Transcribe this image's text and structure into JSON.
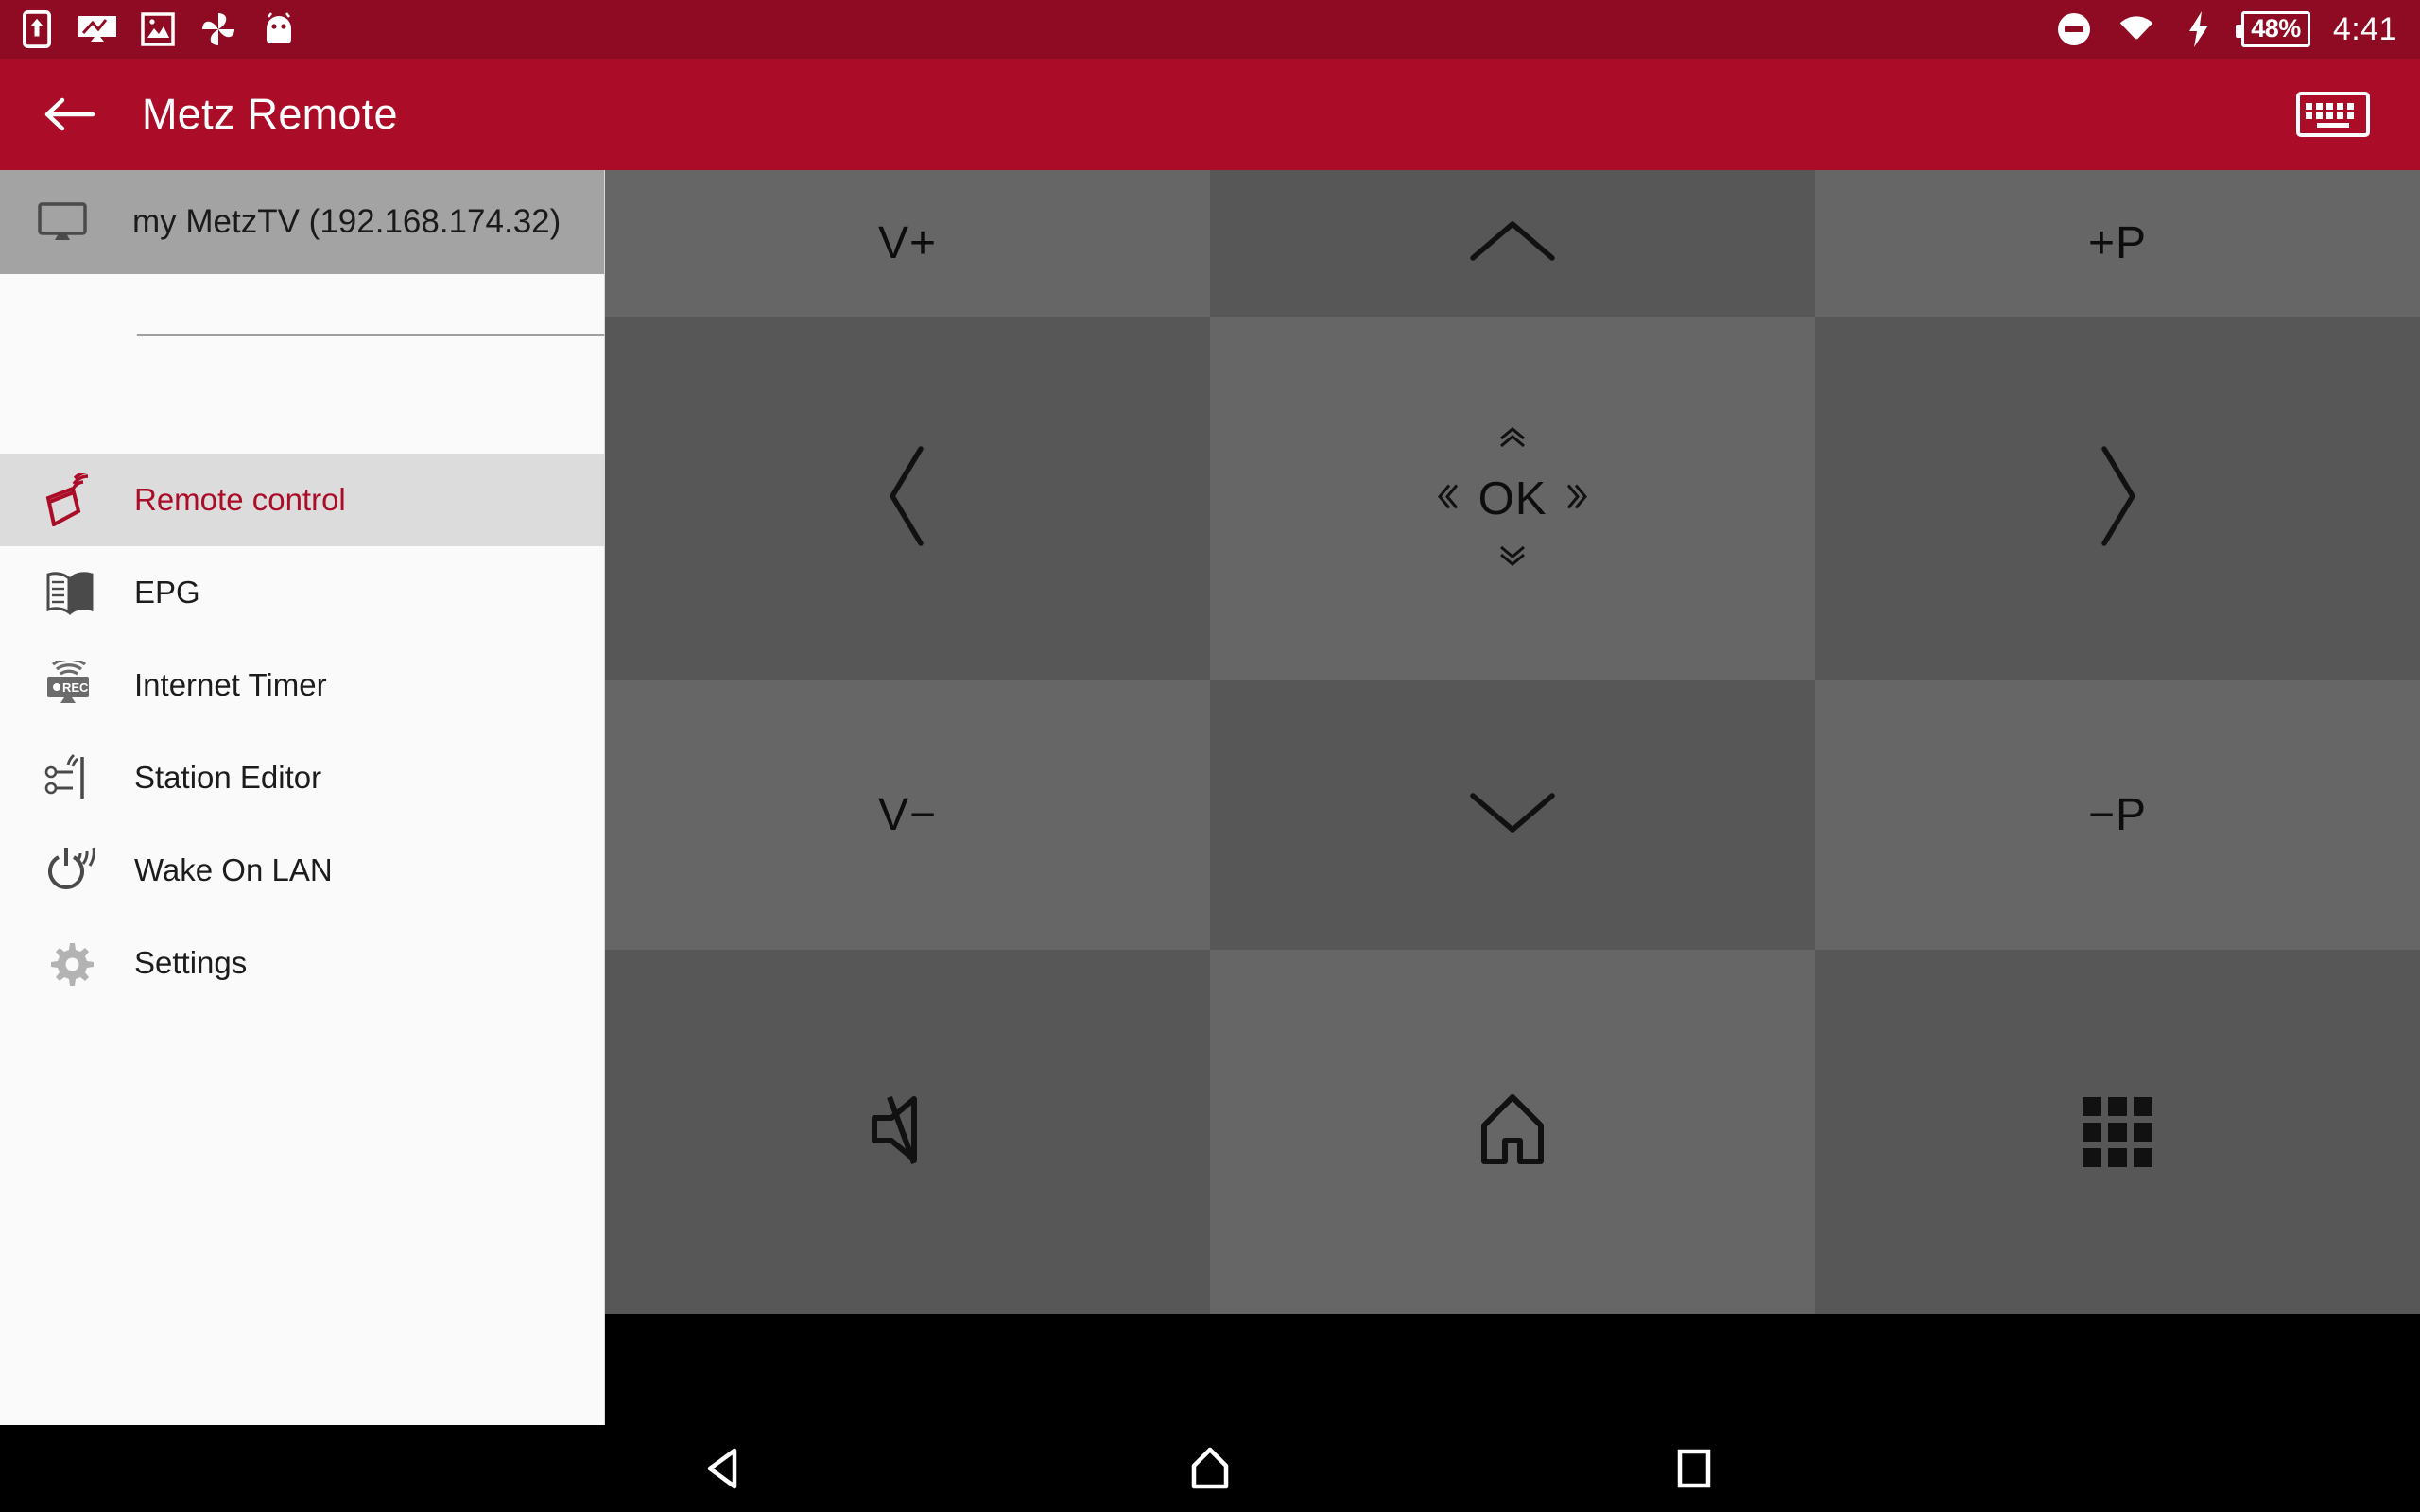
{
  "statusbar": {
    "icons": [
      "screen-cast-upload-icon",
      "screenshot-icon",
      "photo-icon",
      "pinwheel-icon",
      "android-mascot-icon"
    ],
    "dnd_icon": "do-not-disturb-icon",
    "wifi_icon": "wifi-icon",
    "charging_icon": "charging-bolt-icon",
    "battery_level": "48%",
    "clock": "4:41"
  },
  "appbar": {
    "back_icon": "back-arrow-icon",
    "title": "Metz Remote",
    "keyboard_icon": "keyboard-icon"
  },
  "sidebar": {
    "device": {
      "icon": "tv-monitor-icon",
      "name": "my MetzTV (192.168.174.32)"
    },
    "items": [
      {
        "label": "Remote control",
        "icon": "remote-control-icon",
        "selected": true
      },
      {
        "label": "EPG",
        "icon": "open-book-icon",
        "selected": false
      },
      {
        "label": "Internet Timer",
        "icon": "rec-timer-icon",
        "selected": false
      },
      {
        "label": "Station Editor",
        "icon": "station-antenna-icon",
        "selected": false
      },
      {
        "label": "Wake On LAN",
        "icon": "power-wifi-icon",
        "selected": false
      },
      {
        "label": "Settings",
        "icon": "gear-icon",
        "selected": false
      }
    ]
  },
  "remote": {
    "buttons": [
      {
        "name": "volume-up-button",
        "label": "V+",
        "icon": null,
        "shade": "light"
      },
      {
        "name": "nav-up-button",
        "label": "",
        "icon": "chevron-up-icon",
        "shade": "dark"
      },
      {
        "name": "program-up-button",
        "label": "+P",
        "icon": null,
        "shade": "light"
      },
      {
        "name": "nav-left-button",
        "label": "",
        "icon": "chevron-left-icon",
        "shade": "dark"
      },
      {
        "name": "ok-button",
        "label": "OK",
        "icon": "ok-dpad-icon",
        "shade": "light"
      },
      {
        "name": "nav-right-button",
        "label": "",
        "icon": "chevron-right-icon",
        "shade": "dark"
      },
      {
        "name": "volume-down-button",
        "label": "V−",
        "icon": null,
        "shade": "light"
      },
      {
        "name": "nav-down-button",
        "label": "",
        "icon": "chevron-down-icon",
        "shade": "dark"
      },
      {
        "name": "program-down-button",
        "label": "−P",
        "icon": null,
        "shade": "light"
      },
      {
        "name": "mute-button",
        "label": "",
        "icon": "mute-speaker-icon",
        "shade": "dark"
      },
      {
        "name": "home-button",
        "label": "",
        "icon": "home-icon",
        "shade": "light"
      },
      {
        "name": "apps-menu-button",
        "label": "",
        "icon": "apps-grid-icon",
        "shade": "dark"
      }
    ]
  },
  "navbar": {
    "back": "android-back-icon",
    "home": "android-home-icon",
    "recents": "android-recents-icon"
  },
  "colors": {
    "status_bar": "#8e0b23",
    "app_bar": "#ab0c27",
    "accent": "#ab0c27",
    "cell_light": "#666666",
    "cell_dark": "#575757",
    "sidebar_bg": "#fafafa",
    "sidebar_selected": "#dcdcdc",
    "device_row": "#a3a3a3"
  }
}
